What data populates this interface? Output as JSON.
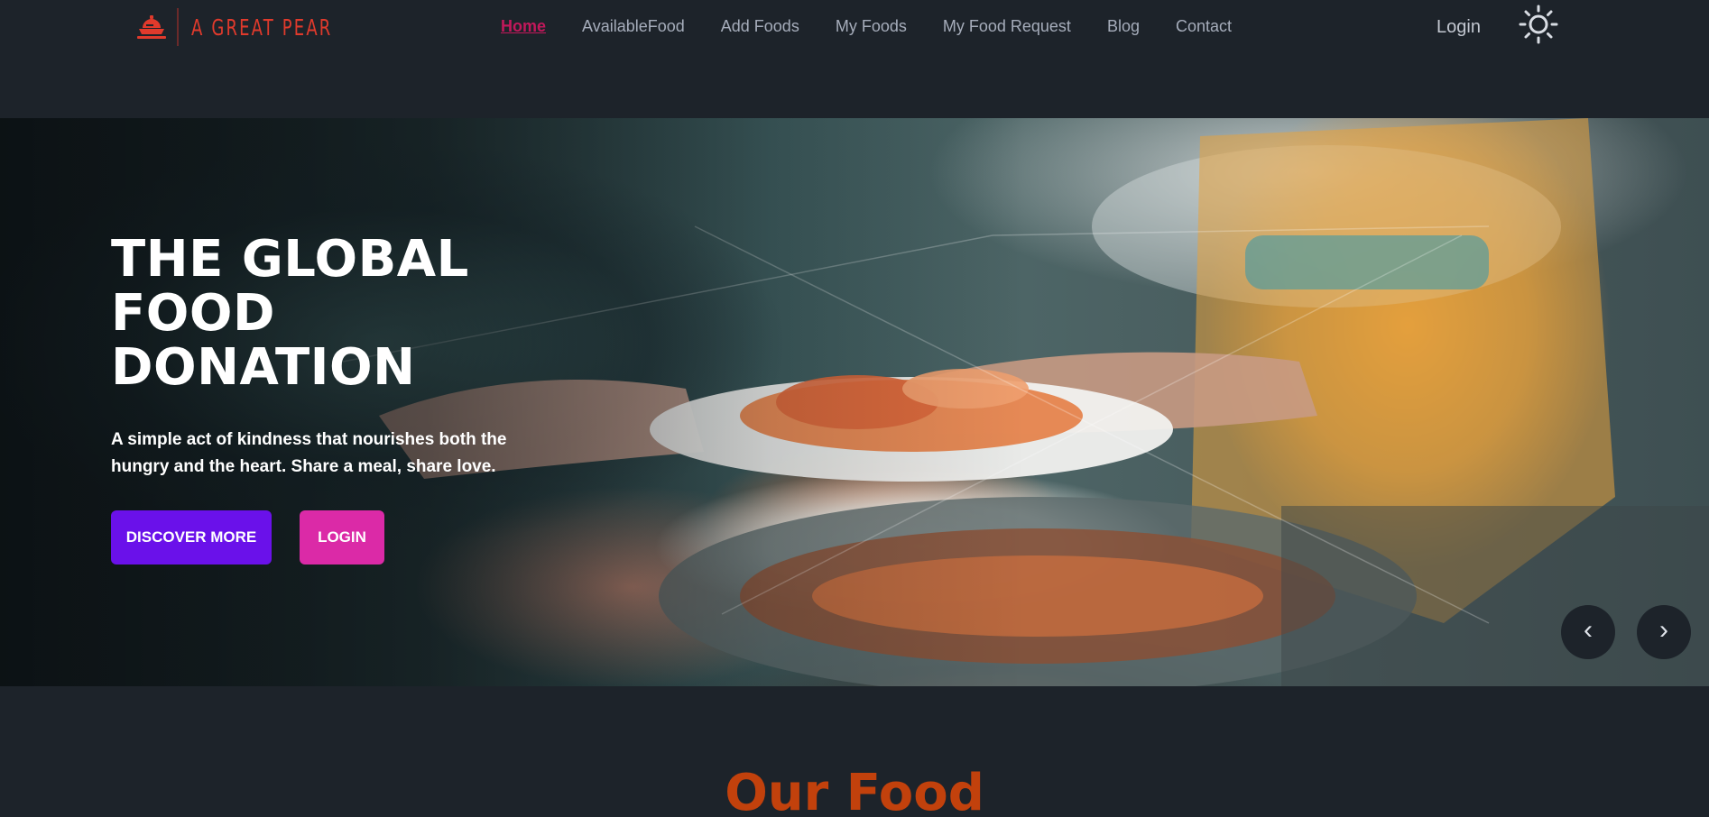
{
  "brand": {
    "name": "A GREAT PEAR",
    "color": "#e03a2c"
  },
  "nav": {
    "items": [
      {
        "label": "Home",
        "active": true
      },
      {
        "label": "AvailableFood",
        "active": false
      },
      {
        "label": "Add Foods",
        "active": false
      },
      {
        "label": "My Foods",
        "active": false
      },
      {
        "label": "My Food Request",
        "active": false
      },
      {
        "label": "Blog",
        "active": false
      },
      {
        "label": "Contact",
        "active": false
      }
    ],
    "login_label": "Login",
    "theme_icon": "sun-icon"
  },
  "hero": {
    "title": "THE GLOBAL FOOD DONATION",
    "subtitle": "A simple act of kindness that nourishes both the hungry and the heart. Share a meal, share love.",
    "discover_label": "DISCOVER MORE",
    "login_label": "LOGIN",
    "prev_label": "‹",
    "next_label": "›",
    "image_icon": "food-donation-photo"
  },
  "section": {
    "title": "Our Food"
  },
  "colors": {
    "background": "#1d232a",
    "active_link": "#c2185b",
    "discover_button": "#6a11ea",
    "login_button": "#db2aa7",
    "section_title": "#c2410c"
  }
}
